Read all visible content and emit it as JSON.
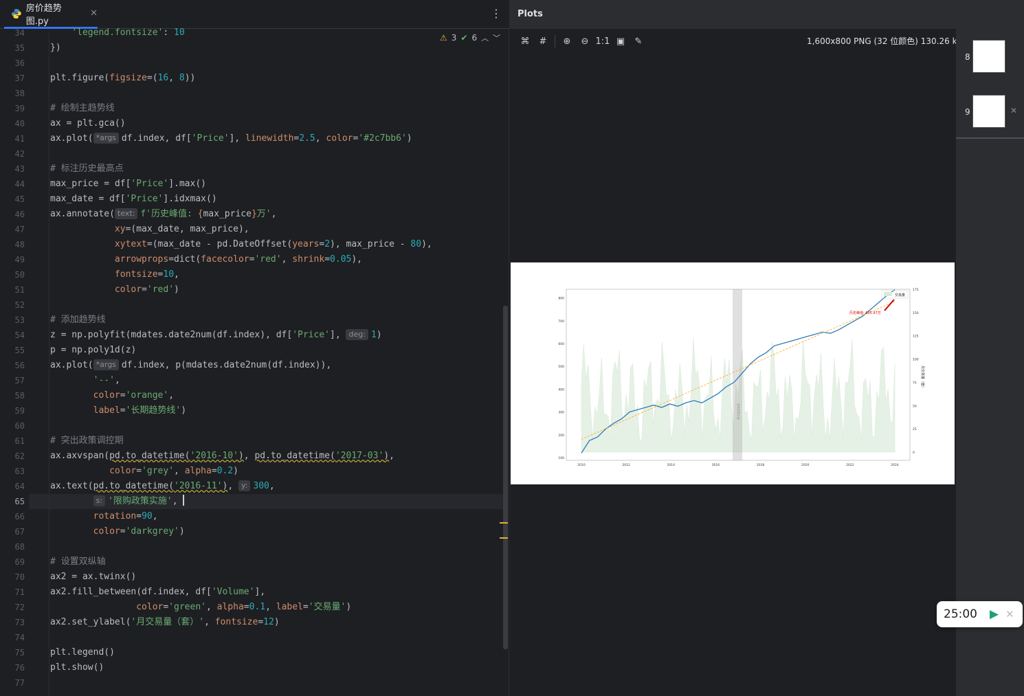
{
  "editor": {
    "tab_name": "房价趋势图.py",
    "inspection": {
      "warnings": "3",
      "checks": "6"
    },
    "current_line": "65",
    "line_numbers": [
      "34",
      "35",
      "36",
      "37",
      "38",
      "39",
      "40",
      "41",
      "42",
      "43",
      "44",
      "45",
      "46",
      "47",
      "48",
      "49",
      "50",
      "51",
      "52",
      "53",
      "54",
      "55",
      "56",
      "57",
      "58",
      "59",
      "60",
      "61",
      "62",
      "63",
      "64",
      "65",
      "66",
      "67",
      "68",
      "69",
      "70",
      "71",
      "72",
      "73",
      "74",
      "75",
      "76",
      "77"
    ],
    "hints": {
      "args": "*args",
      "text": "text:",
      "deg": "deg:",
      "y": "y:",
      "s": "s:"
    }
  },
  "plots": {
    "title": "Plots",
    "info": "1,600x800 PNG (32 位颜色) 130.26 kB",
    "zoom_label": "1:1",
    "thumbnails": [
      {
        "num": "8"
      },
      {
        "num": "9"
      }
    ]
  },
  "timer": {
    "time": "25:00"
  },
  "chart_data": {
    "type": "line",
    "x": [
      "2010",
      "2012",
      "2014",
      "2016",
      "2018",
      "2020",
      "2022",
      "2024"
    ],
    "y_ticks": [
      "100",
      "200",
      "300",
      "400",
      "500",
      "600",
      "700",
      "800"
    ],
    "y2_ticks": [
      "0",
      "25",
      "50",
      "75",
      "100",
      "125",
      "150",
      "175"
    ],
    "y2label": "月交易量（套）",
    "legend": {
      "label": "交易量",
      "placement": "top-right"
    },
    "annotation": "历史峰值: 835.97万",
    "span_label": "限购政策实施",
    "series": [
      {
        "color": "#2c7bb6",
        "values": [
          120,
          175,
          190,
          225,
          250,
          270,
          300,
          310,
          320,
          330,
          320,
          335,
          325,
          340,
          350,
          340,
          360,
          380,
          410,
          430,
          470,
          510,
          540,
          560,
          590,
          600,
          610,
          620,
          630,
          640,
          650,
          645,
          660,
          680,
          700,
          720,
          750,
          780,
          810,
          836
        ]
      },
      {
        "color": "orange",
        "values": [
          180,
          235,
          290,
          345,
          400,
          455,
          510,
          565,
          620,
          675,
          730,
          785
        ]
      }
    ]
  }
}
